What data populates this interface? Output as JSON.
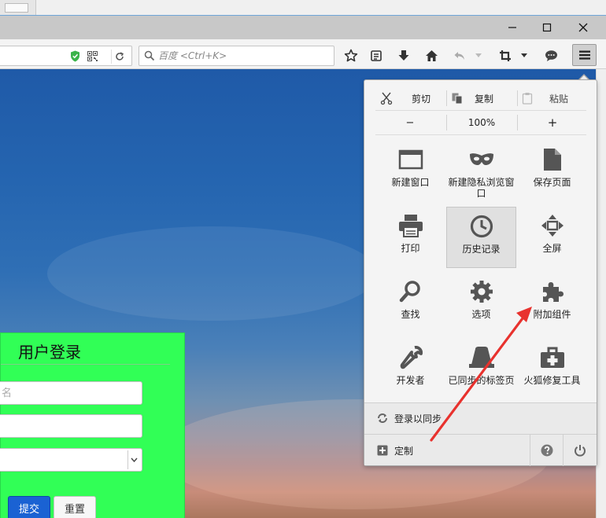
{
  "navbar": {
    "search_placeholder": "百度 <Ctrl+K>"
  },
  "menu": {
    "edit": {
      "cut": "剪切",
      "copy": "复制",
      "paste": "粘贴"
    },
    "zoom": {
      "minus": "−",
      "level": "100%",
      "plus": "+"
    },
    "items": [
      {
        "label": "新建窗口",
        "icon": "new-window-icon"
      },
      {
        "label": "新建隐私浏览窗口",
        "icon": "private-mask-icon"
      },
      {
        "label": "保存页面",
        "icon": "save-page-icon"
      },
      {
        "label": "打印",
        "icon": "printer-icon"
      },
      {
        "label": "历史记录",
        "icon": "history-clock-icon"
      },
      {
        "label": "全屏",
        "icon": "fullscreen-icon"
      },
      {
        "label": "查找",
        "icon": "find-magnifier-icon"
      },
      {
        "label": "选项",
        "icon": "options-gear-icon"
      },
      {
        "label": "附加组件",
        "icon": "addons-puzzle-icon"
      },
      {
        "label": "开发者",
        "icon": "developer-wrench-icon"
      },
      {
        "label": "已同步的标签页",
        "icon": "synced-tabs-icon"
      },
      {
        "label": "火狐修复工具",
        "icon": "repair-toolkit-icon"
      }
    ],
    "sync_label": "登录以同步",
    "customize_label": "定制"
  },
  "login": {
    "title": "用户登录",
    "username_placeholder": "名",
    "submit_label": "提交",
    "reset_label": "重置"
  },
  "colors": {
    "login_bg": "#31ff56",
    "submit_bg": "#1a62d3",
    "annotation_arrow": "#e8322e"
  }
}
